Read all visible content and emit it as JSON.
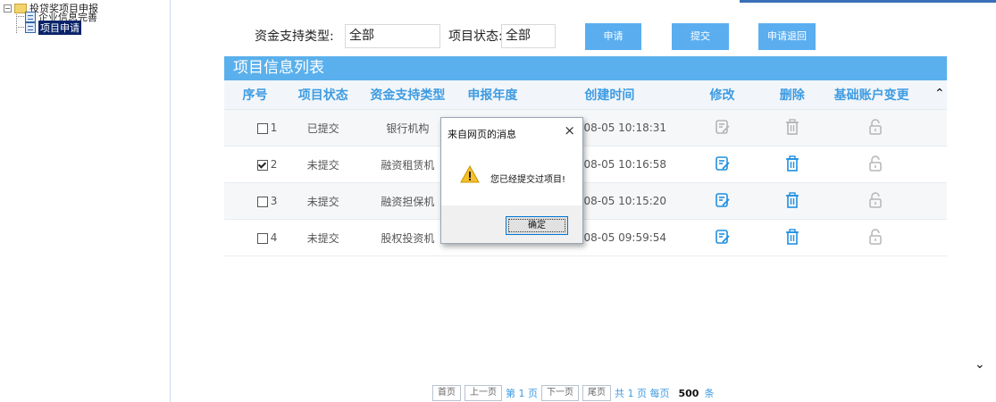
{
  "top_strip_text": "",
  "tree": {
    "root": "投贷奖项目申报",
    "children": [
      "企业信息完善",
      "项目申请"
    ]
  },
  "filters": {
    "support_type_label": "资金支持类型:",
    "support_type_value": "全部",
    "status_label": "项目状态:",
    "status_value": "全部"
  },
  "buttons": {
    "apply": "申请",
    "submit": "提交",
    "withdraw": "申请退回"
  },
  "table": {
    "title": "项目信息列表",
    "columns": [
      "序号",
      "项目状态",
      "资金支持类型",
      "申报年度",
      "创建时间",
      "修改",
      "删除",
      "基础账户变更"
    ],
    "rows": [
      {
        "no": "1",
        "checked": false,
        "status": "已提交",
        "type": "银行机构",
        "year": "",
        "created": "2022-08-05 10:18:31",
        "editable": false
      },
      {
        "no": "2",
        "checked": true,
        "status": "未提交",
        "type": "融资租赁机",
        "year": "",
        "created": "2022-08-05 10:16:58",
        "editable": true
      },
      {
        "no": "3",
        "checked": false,
        "status": "未提交",
        "type": "融资担保机",
        "year": "",
        "created": "2022-08-05 10:15:20",
        "editable": true
      },
      {
        "no": "4",
        "checked": false,
        "status": "未提交",
        "type": "股权投资机",
        "year": "",
        "created": "2022-08-05 09:59:54",
        "editable": true
      }
    ]
  },
  "dialog": {
    "title": "来自网页的消息",
    "message": "您已经提交过项目!",
    "ok": "确定"
  },
  "pager": {
    "first": "首页",
    "prev": "上一页",
    "current": "第 1 页",
    "next": "下一页",
    "last": "尾页",
    "total": "共 1 页 每页",
    "per_page": "500",
    "unit": "条"
  },
  "colors": {
    "accent": "#5ab0ec",
    "header_text": "#3d9be2",
    "icon_active": "#1f8fe0",
    "icon_disabled": "#b5b5b5"
  }
}
